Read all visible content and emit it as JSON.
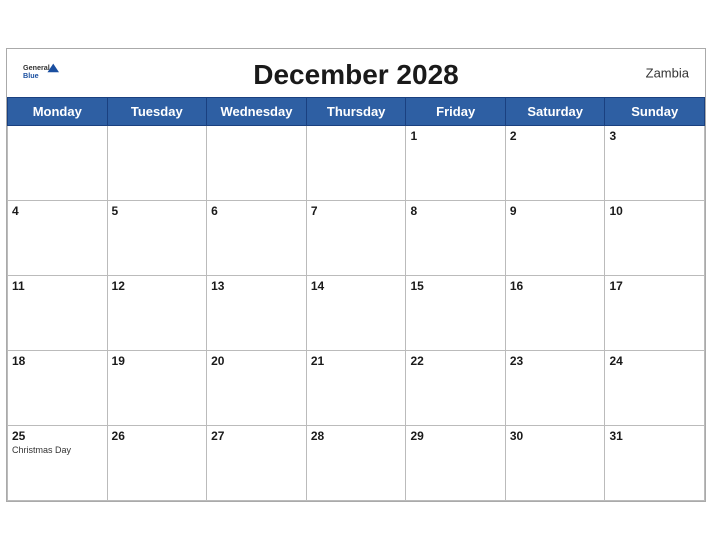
{
  "header": {
    "title": "December 2028",
    "country": "Zambia",
    "logo": {
      "general": "General",
      "blue": "Blue"
    }
  },
  "weekdays": [
    "Monday",
    "Tuesday",
    "Wednesday",
    "Thursday",
    "Friday",
    "Saturday",
    "Sunday"
  ],
  "weeks": [
    [
      {
        "day": "",
        "events": []
      },
      {
        "day": "",
        "events": []
      },
      {
        "day": "",
        "events": []
      },
      {
        "day": "",
        "events": []
      },
      {
        "day": "1",
        "events": []
      },
      {
        "day": "2",
        "events": []
      },
      {
        "day": "3",
        "events": []
      }
    ],
    [
      {
        "day": "4",
        "events": []
      },
      {
        "day": "5",
        "events": []
      },
      {
        "day": "6",
        "events": []
      },
      {
        "day": "7",
        "events": []
      },
      {
        "day": "8",
        "events": []
      },
      {
        "day": "9",
        "events": []
      },
      {
        "day": "10",
        "events": []
      }
    ],
    [
      {
        "day": "11",
        "events": []
      },
      {
        "day": "12",
        "events": []
      },
      {
        "day": "13",
        "events": []
      },
      {
        "day": "14",
        "events": []
      },
      {
        "day": "15",
        "events": []
      },
      {
        "day": "16",
        "events": []
      },
      {
        "day": "17",
        "events": []
      }
    ],
    [
      {
        "day": "18",
        "events": []
      },
      {
        "day": "19",
        "events": []
      },
      {
        "day": "20",
        "events": []
      },
      {
        "day": "21",
        "events": []
      },
      {
        "day": "22",
        "events": []
      },
      {
        "day": "23",
        "events": []
      },
      {
        "day": "24",
        "events": []
      }
    ],
    [
      {
        "day": "25",
        "events": [
          "Christmas Day"
        ]
      },
      {
        "day": "26",
        "events": []
      },
      {
        "day": "27",
        "events": []
      },
      {
        "day": "28",
        "events": []
      },
      {
        "day": "29",
        "events": []
      },
      {
        "day": "30",
        "events": []
      },
      {
        "day": "31",
        "events": []
      }
    ]
  ],
  "colors": {
    "header_bg": "#2e5fa3",
    "accent_blue": "#1a4fa0"
  }
}
